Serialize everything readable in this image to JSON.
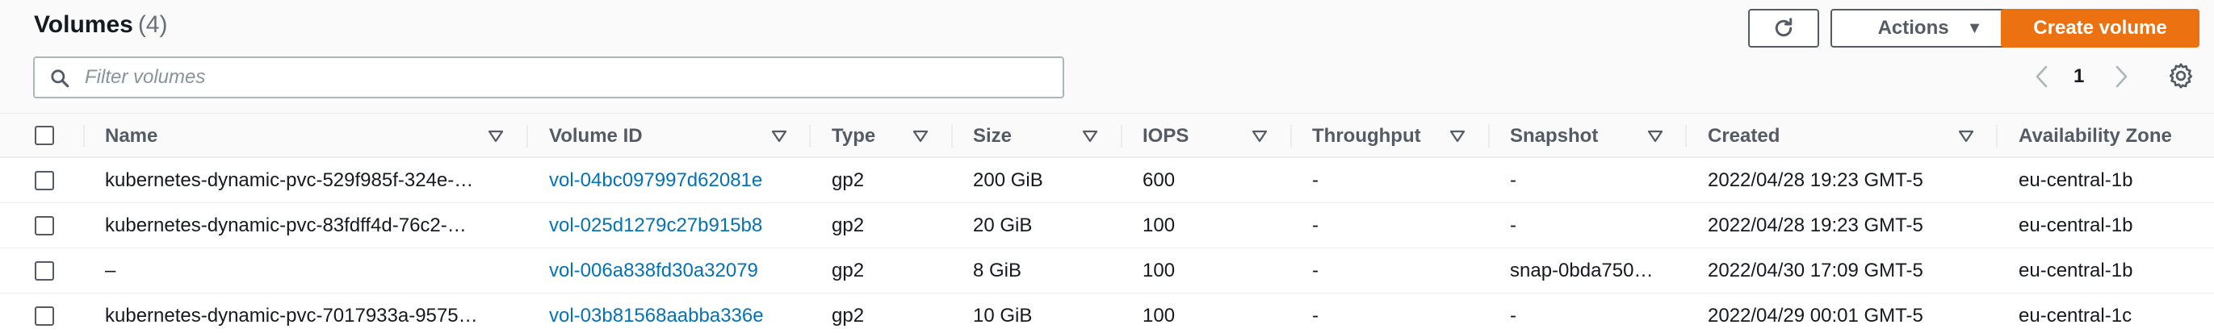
{
  "header": {
    "title": "Volumes",
    "count": "(4)",
    "actions_label": "Actions",
    "create_label": "Create volume"
  },
  "filter": {
    "placeholder": "Filter volumes",
    "value": ""
  },
  "pagination": {
    "current_page": "1"
  },
  "columns": [
    "Name",
    "Volume ID",
    "Type",
    "Size",
    "IOPS",
    "Throughput",
    "Snapshot",
    "Created",
    "Availability Zone"
  ],
  "rows": [
    {
      "name": "kubernetes-dynamic-pvc-529f985f-324e-…",
      "volume_id": "vol-04bc097997d62081e",
      "type": "gp2",
      "size": "200 GiB",
      "iops": "600",
      "throughput": "-",
      "snapshot": "-",
      "created": "2022/04/28 19:23 GMT-5",
      "az": "eu-central-1b"
    },
    {
      "name": "kubernetes-dynamic-pvc-83fdff4d-76c2-…",
      "volume_id": "vol-025d1279c27b915b8",
      "type": "gp2",
      "size": "20 GiB",
      "iops": "100",
      "throughput": "-",
      "snapshot": "-",
      "created": "2022/04/28 19:23 GMT-5",
      "az": "eu-central-1b"
    },
    {
      "name": "–",
      "volume_id": "vol-006a838fd30a32079",
      "type": "gp2",
      "size": "8 GiB",
      "iops": "100",
      "throughput": "-",
      "snapshot": "snap-0bda750…",
      "created": "2022/04/30 17:09 GMT-5",
      "az": "eu-central-1b"
    },
    {
      "name": "kubernetes-dynamic-pvc-7017933a-9575…",
      "volume_id": "vol-03b81568aabba336e",
      "type": "gp2",
      "size": "10 GiB",
      "iops": "100",
      "throughput": "-",
      "snapshot": "-",
      "created": "2022/04/29 00:01 GMT-5",
      "az": "eu-central-1c"
    }
  ],
  "colors": {
    "accent": "#ec7211",
    "link": "#0073bb",
    "text": "#16191f",
    "muted": "#545b64"
  },
  "icons": {
    "refresh": "refresh-icon",
    "caret": "caret-down-icon",
    "search": "search-icon",
    "prev": "chevron-left-icon",
    "next": "chevron-right-icon",
    "settings": "gear-icon",
    "sort": "sort-down-icon"
  }
}
